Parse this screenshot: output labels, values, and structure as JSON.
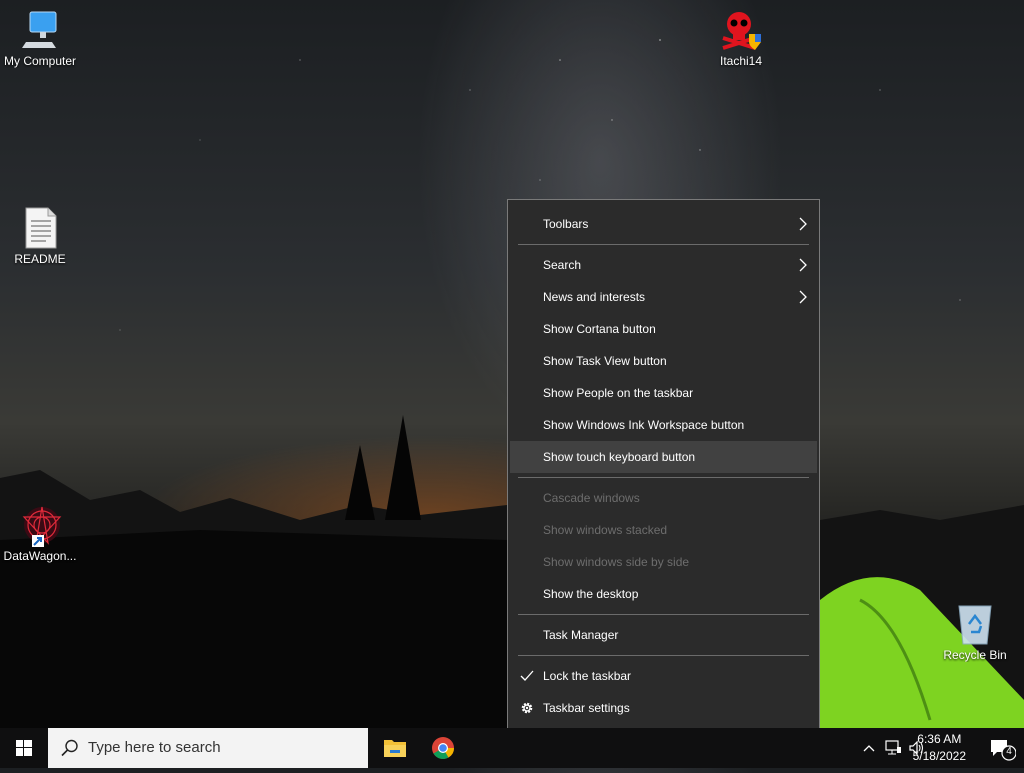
{
  "desktop": {
    "icons": [
      {
        "label": "My Computer",
        "icon": "computer-icon"
      },
      {
        "label": "Itachi14",
        "icon": "skull-shield-icon"
      },
      {
        "label": "README",
        "icon": "text-file-icon"
      },
      {
        "label": "DataWagon...",
        "icon": "datawagon-shortcut-icon"
      },
      {
        "label": "Recycle Bin",
        "icon": "recycle-bin-icon"
      }
    ]
  },
  "context_menu": {
    "items": [
      {
        "label": "Toolbars",
        "submenu": true
      },
      {
        "label": "Search",
        "submenu": true
      },
      {
        "label": "News and interests",
        "submenu": true
      },
      {
        "label": "Show Cortana button"
      },
      {
        "label": "Show Task View button"
      },
      {
        "label": "Show People on the taskbar"
      },
      {
        "label": "Show Windows Ink Workspace button"
      },
      {
        "label": "Show touch keyboard button",
        "highlighted": true
      },
      {
        "label": "Cascade windows",
        "disabled": true
      },
      {
        "label": "Show windows stacked",
        "disabled": true
      },
      {
        "label": "Show windows side by side",
        "disabled": true
      },
      {
        "label": "Show the desktop"
      },
      {
        "label": "Task Manager"
      },
      {
        "label": "Lock the taskbar",
        "checked": true
      },
      {
        "label": "Taskbar settings",
        "icon": "gear-icon"
      }
    ]
  },
  "taskbar": {
    "search_placeholder": "Type here to search",
    "pinned": [
      "file-explorer-icon",
      "chrome-icon"
    ],
    "clock": {
      "time": "6:36 AM",
      "date": "5/18/2022"
    },
    "notifications_count": "4"
  },
  "colors": {
    "menu_bg": "#2b2b2b",
    "menu_highlight": "#414141",
    "taskbar_bg": "#0f0f10",
    "tent_green": "#7ed321"
  }
}
